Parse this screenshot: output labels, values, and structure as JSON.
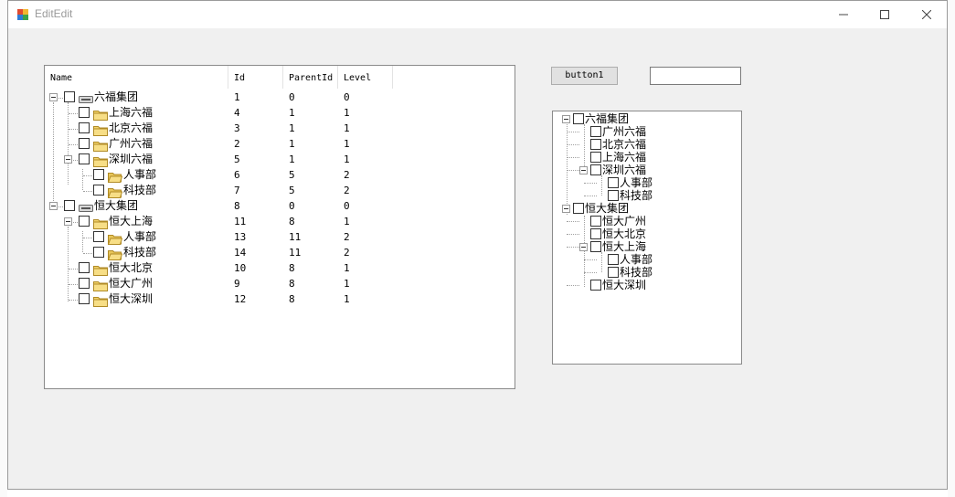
{
  "window": {
    "title": "EditEdit"
  },
  "treelist": {
    "columns": [
      "Name",
      "Id",
      "ParentId",
      "Level"
    ],
    "rows": [
      {
        "name": "六福集团",
        "id": "1",
        "parent": "0",
        "level": "0",
        "icon": "group-icon"
      },
      {
        "name": "上海六福",
        "id": "4",
        "parent": "1",
        "level": "1",
        "icon": "folder-icon"
      },
      {
        "name": "北京六福",
        "id": "3",
        "parent": "1",
        "level": "1",
        "icon": "folder-icon"
      },
      {
        "name": "广州六福",
        "id": "2",
        "parent": "1",
        "level": "1",
        "icon": "folder-icon"
      },
      {
        "name": "深圳六福",
        "id": "5",
        "parent": "1",
        "level": "1",
        "icon": "folder-icon"
      },
      {
        "name": "人事部",
        "id": "6",
        "parent": "5",
        "level": "2",
        "icon": "folder-open-icon"
      },
      {
        "name": "科技部",
        "id": "7",
        "parent": "5",
        "level": "2",
        "icon": "folder-open-icon"
      },
      {
        "name": "恒大集团",
        "id": "8",
        "parent": "0",
        "level": "0",
        "icon": "group-icon"
      },
      {
        "name": "恒大上海",
        "id": "11",
        "parent": "8",
        "level": "1",
        "icon": "folder-icon"
      },
      {
        "name": "人事部",
        "id": "13",
        "parent": "11",
        "level": "2",
        "icon": "folder-open-icon"
      },
      {
        "name": "科技部",
        "id": "14",
        "parent": "11",
        "level": "2",
        "icon": "folder-open-icon"
      },
      {
        "name": "恒大北京",
        "id": "10",
        "parent": "8",
        "level": "1",
        "icon": "folder-icon"
      },
      {
        "name": "恒大广州",
        "id": "9",
        "parent": "8",
        "level": "1",
        "icon": "folder-icon"
      },
      {
        "name": "恒大深圳",
        "id": "12",
        "parent": "8",
        "level": "1",
        "icon": "folder-icon"
      }
    ]
  },
  "button1": {
    "label": "button1"
  },
  "textbox": {
    "value": ""
  },
  "treeview": {
    "nodes": [
      "六福集团",
      "广州六福",
      "北京六福",
      "上海六福",
      "深圳六福",
      "人事部",
      "科技部",
      "恒大集团",
      "恒大广州",
      "恒大北京",
      "恒大上海",
      "人事部",
      "科技部",
      "恒大深圳"
    ]
  }
}
